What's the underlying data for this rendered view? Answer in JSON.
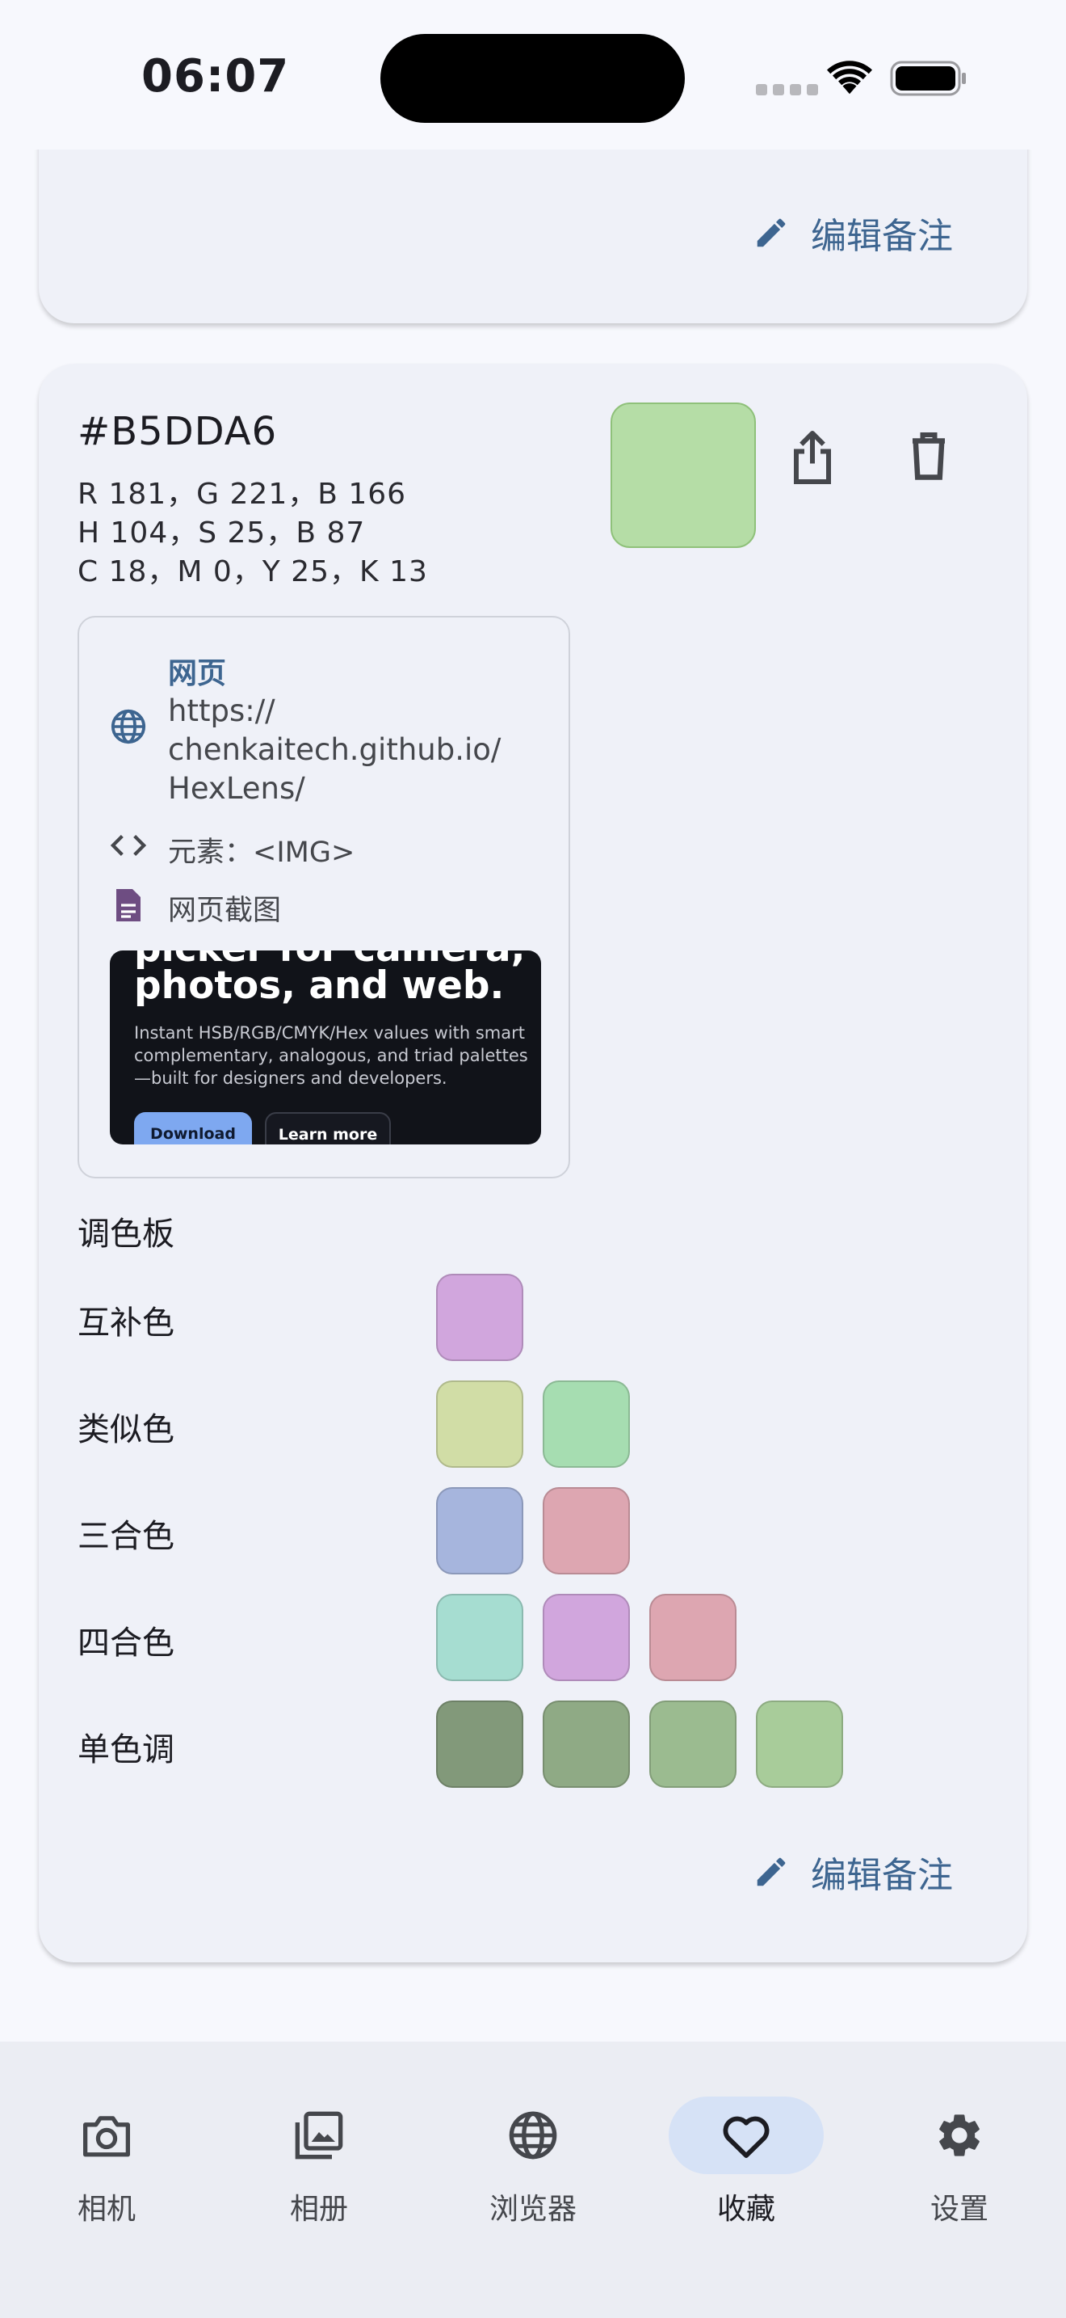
{
  "status_bar": {
    "time": "06:07"
  },
  "top_card": {
    "edit_note_label": "编辑备注"
  },
  "color_card": {
    "hex": "#B5DDA6",
    "swatch_color": "#B5DDA6",
    "rgb_text": "R 181，G 221，B 166",
    "hsb_text": "H 104，S 25，B 87",
    "cmyk_text": "C 18，M 0，Y 25，K 13",
    "source": {
      "type_label": "网页",
      "url_line1": "https://",
      "url_line2": "chenkaitech.github.io/",
      "url_line3": "HexLens/",
      "element_text": "元素：<IMG>",
      "screenshot_label": "网页截图",
      "preview": {
        "headline_partial": "picker for camera,",
        "headline": "photos, and web.",
        "description": "Instant HSB/RGB/CMYK/Hex values with smart complementary, analogous, and triad palettes—built for designers and developers.",
        "download_button": "Download",
        "learn_more_button": "Learn more"
      }
    },
    "palette_heading": "调色板",
    "palettes": [
      {
        "label": "互补色",
        "colors": [
          "#D1A6DD"
        ]
      },
      {
        "label": "类似色",
        "colors": [
          "#D1DDA6",
          "#A6DDB1"
        ]
      },
      {
        "label": "三合色",
        "colors": [
          "#A6B5DD",
          "#DDA6B1"
        ]
      },
      {
        "label": "四合色",
        "colors": [
          "#A6DDD1",
          "#D1A6DD",
          "#DDA6B1"
        ]
      },
      {
        "label": "单色调",
        "colors": [
          "#82997A",
          "#8FAA85",
          "#9BBB90",
          "#A8CC9A"
        ]
      }
    ],
    "edit_note_label": "编辑备注"
  },
  "bottom_nav": {
    "items": [
      {
        "label": "相机",
        "icon": "camera-icon",
        "active": false
      },
      {
        "label": "相册",
        "icon": "gallery-icon",
        "active": false
      },
      {
        "label": "浏览器",
        "icon": "globe-icon",
        "active": false
      },
      {
        "label": "收藏",
        "icon": "heart-icon",
        "active": true
      },
      {
        "label": "设置",
        "icon": "gear-icon",
        "active": false
      }
    ]
  },
  "colors": {
    "accent": "#3D6590",
    "card_bg": "#EFF1F8",
    "page_bg": "#F7F8FD",
    "nav_active_pill": "#D6E2F6"
  }
}
